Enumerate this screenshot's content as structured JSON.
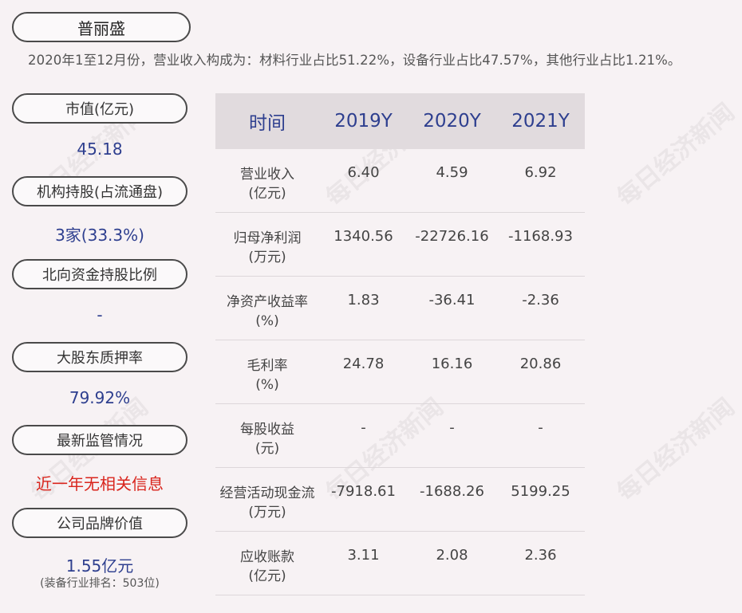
{
  "company": "普丽盛",
  "summary": "2020年1至12月份，营业收入构成为：材料行业占比51.22%，设备行业占比47.57%，其他行业占比1.21%。",
  "left_panel": {
    "market_cap": {
      "label": "市值(亿元)",
      "value": "45.18"
    },
    "institutions": {
      "label": "机构持股(占流通盘)",
      "value": "3家(33.3%)"
    },
    "northbound": {
      "label": "北向资金持股比例",
      "value": "-"
    },
    "pledge": {
      "label": "大股东质押率",
      "value": "79.92%"
    },
    "regulation": {
      "label": "最新监管情况",
      "value": "近一年无相关信息"
    },
    "brand": {
      "label": "公司品牌价值",
      "value": "1.55亿元",
      "note": "(装备行业排名：503位)"
    }
  },
  "table": {
    "headers": [
      "时间",
      "2019Y",
      "2020Y",
      "2021Y"
    ],
    "rows": [
      {
        "label": "营业收入",
        "unit": "(亿元)",
        "values": [
          "6.40",
          "4.59",
          "6.92"
        ]
      },
      {
        "label": "归母净利润",
        "unit": "(万元)",
        "values": [
          "1340.56",
          "-22726.16",
          "-1168.93"
        ]
      },
      {
        "label": "净资产收益率",
        "unit": "(%)",
        "values": [
          "1.83",
          "-36.41",
          "-2.36"
        ]
      },
      {
        "label": "毛利率",
        "unit": "(%)",
        "values": [
          "24.78",
          "16.16",
          "20.86"
        ]
      },
      {
        "label": "每股收益",
        "unit": "(元)",
        "values": [
          "-",
          "-",
          "-"
        ]
      },
      {
        "label": "经营活动现金流",
        "unit": "(万元)",
        "values": [
          "-7918.61",
          "-1688.26",
          "5199.25"
        ]
      },
      {
        "label": "应收账款",
        "unit": "(亿元)",
        "values": [
          "3.11",
          "2.08",
          "2.36"
        ]
      }
    ]
  },
  "watermark": "每日经济新闻"
}
